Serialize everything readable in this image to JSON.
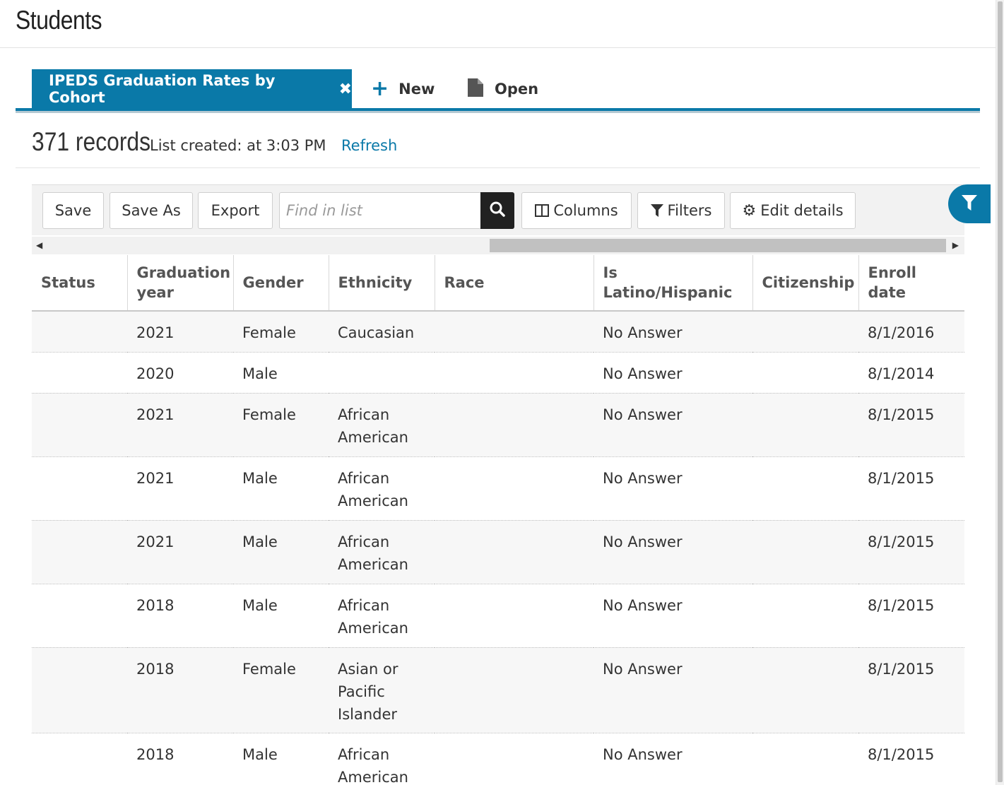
{
  "page": {
    "title": "Students"
  },
  "tabs": {
    "active": {
      "label": "IPEDS Graduation Rates by Cohort"
    },
    "new_label": "New",
    "open_label": "Open"
  },
  "summary": {
    "record_count": "371 records",
    "list_created": "List created: at 3:03 PM",
    "refresh_label": "Refresh"
  },
  "toolbar": {
    "save_label": "Save",
    "save_as_label": "Save As",
    "export_label": "Export",
    "search_placeholder": "Find in list",
    "columns_label": "Columns",
    "filters_label": "Filters",
    "edit_details_label": "Edit details"
  },
  "icons": {
    "close": "close-icon",
    "plus": "plus-icon",
    "document": "document-icon",
    "search": "search-icon",
    "columns": "columns-icon",
    "filter": "filter-icon",
    "gear": "gear-icon"
  },
  "colors": {
    "accent": "#0a79a8"
  },
  "table": {
    "columns": [
      "Status",
      "Graduation year",
      "Gender",
      "Ethnicity",
      "Race",
      "Is Latino/Hispanic",
      "Citizenship",
      "Enroll date"
    ],
    "rows": [
      {
        "status": "",
        "grad_year": "2021",
        "gender": "Female",
        "ethnicity": "Caucasian",
        "race": "",
        "latino": "No Answer",
        "citizenship": "",
        "enroll": "8/1/2016"
      },
      {
        "status": "",
        "grad_year": "2020",
        "gender": "Male",
        "ethnicity": "",
        "race": "",
        "latino": "No Answer",
        "citizenship": "",
        "enroll": "8/1/2014"
      },
      {
        "status": "",
        "grad_year": "2021",
        "gender": "Female",
        "ethnicity": "African American",
        "race": "",
        "latino": "No Answer",
        "citizenship": "",
        "enroll": "8/1/2015"
      },
      {
        "status": "",
        "grad_year": "2021",
        "gender": "Male",
        "ethnicity": "African American",
        "race": "",
        "latino": "No Answer",
        "citizenship": "",
        "enroll": "8/1/2015"
      },
      {
        "status": "",
        "grad_year": "2021",
        "gender": "Male",
        "ethnicity": "African American",
        "race": "",
        "latino": "No Answer",
        "citizenship": "",
        "enroll": "8/1/2015"
      },
      {
        "status": "",
        "grad_year": "2018",
        "gender": "Male",
        "ethnicity": "African American",
        "race": "",
        "latino": "No Answer",
        "citizenship": "",
        "enroll": "8/1/2015"
      },
      {
        "status": "",
        "grad_year": "2018",
        "gender": "Female",
        "ethnicity": "Asian or Pacific Islander",
        "race": "",
        "latino": "No Answer",
        "citizenship": "",
        "enroll": "8/1/2015"
      },
      {
        "status": "",
        "grad_year": "2018",
        "gender": "Male",
        "ethnicity": "African American",
        "race": "",
        "latino": "No Answer",
        "citizenship": "",
        "enroll": "8/1/2015"
      }
    ]
  }
}
